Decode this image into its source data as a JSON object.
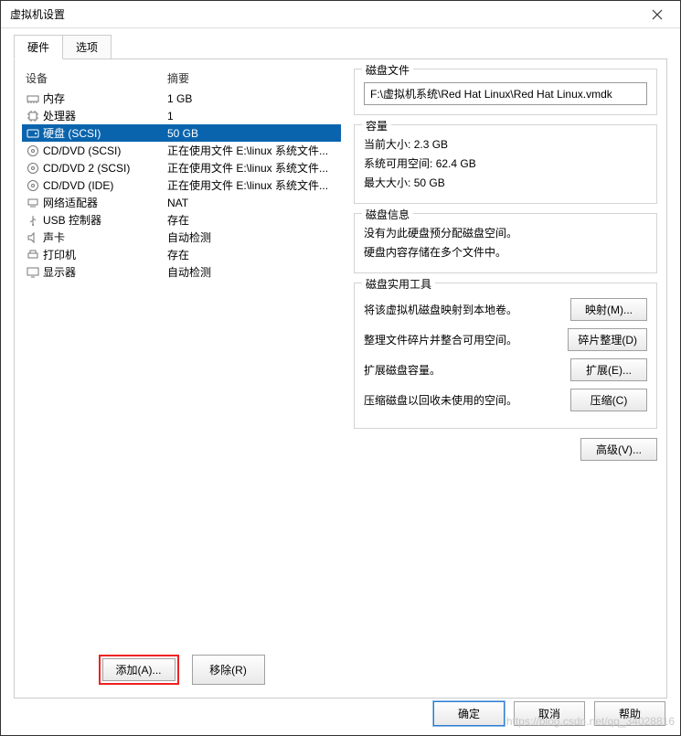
{
  "window": {
    "title": "虚拟机设置"
  },
  "tabs": {
    "hardware": "硬件",
    "options": "选项"
  },
  "headers": {
    "device": "设备",
    "summary": "摘要"
  },
  "devices": [
    {
      "icon": "memory-icon",
      "name": "内存",
      "summary": "1 GB"
    },
    {
      "icon": "cpu-icon",
      "name": "处理器",
      "summary": "1"
    },
    {
      "icon": "disk-icon",
      "name": "硬盘 (SCSI)",
      "summary": "50 GB",
      "selected": true
    },
    {
      "icon": "cd-icon",
      "name": "CD/DVD (SCSI)",
      "summary": "正在使用文件 E:\\linux 系统文件..."
    },
    {
      "icon": "cd-icon",
      "name": "CD/DVD 2 (SCSI)",
      "summary": "正在使用文件 E:\\linux 系统文件..."
    },
    {
      "icon": "cd-icon",
      "name": "CD/DVD (IDE)",
      "summary": "正在使用文件 E:\\linux 系统文件..."
    },
    {
      "icon": "network-icon",
      "name": "网络适配器",
      "summary": "NAT"
    },
    {
      "icon": "usb-icon",
      "name": "USB 控制器",
      "summary": "存在"
    },
    {
      "icon": "sound-icon",
      "name": "声卡",
      "summary": "自动检测"
    },
    {
      "icon": "printer-icon",
      "name": "打印机",
      "summary": "存在"
    },
    {
      "icon": "display-icon",
      "name": "显示器",
      "summary": "自动检测"
    }
  ],
  "buttons": {
    "add": "添加(A)...",
    "remove": "移除(R)",
    "ok": "确定",
    "cancel": "取消",
    "help": "帮助"
  },
  "right": {
    "disk_file": {
      "title": "磁盘文件",
      "path": "F:\\虚拟机系统\\Red Hat Linux\\Red Hat Linux.vmdk"
    },
    "capacity": {
      "title": "容量",
      "current_size_label": "当前大小:",
      "current_size": "2.3 GB",
      "free_label": "系统可用空间:",
      "free": "62.4 GB",
      "max_label": "最大大小:",
      "max": "50 GB"
    },
    "disk_info": {
      "title": "磁盘信息",
      "line1": "没有为此硬盘预分配磁盘空间。",
      "line2": "硬盘内容存储在多个文件中。"
    },
    "utils": {
      "title": "磁盘实用工具",
      "map_text": "将该虚拟机磁盘映射到本地卷。",
      "map_btn": "映射(M)...",
      "defrag_text": "整理文件碎片并整合可用空间。",
      "defrag_btn": "碎片整理(D)",
      "expand_text": "扩展磁盘容量。",
      "expand_btn": "扩展(E)...",
      "compact_text": "压缩磁盘以回收未使用的空间。",
      "compact_btn": "压缩(C)"
    },
    "advanced_btn": "高级(V)..."
  },
  "watermark": "https://blog.csdn.net/qq_34028816"
}
